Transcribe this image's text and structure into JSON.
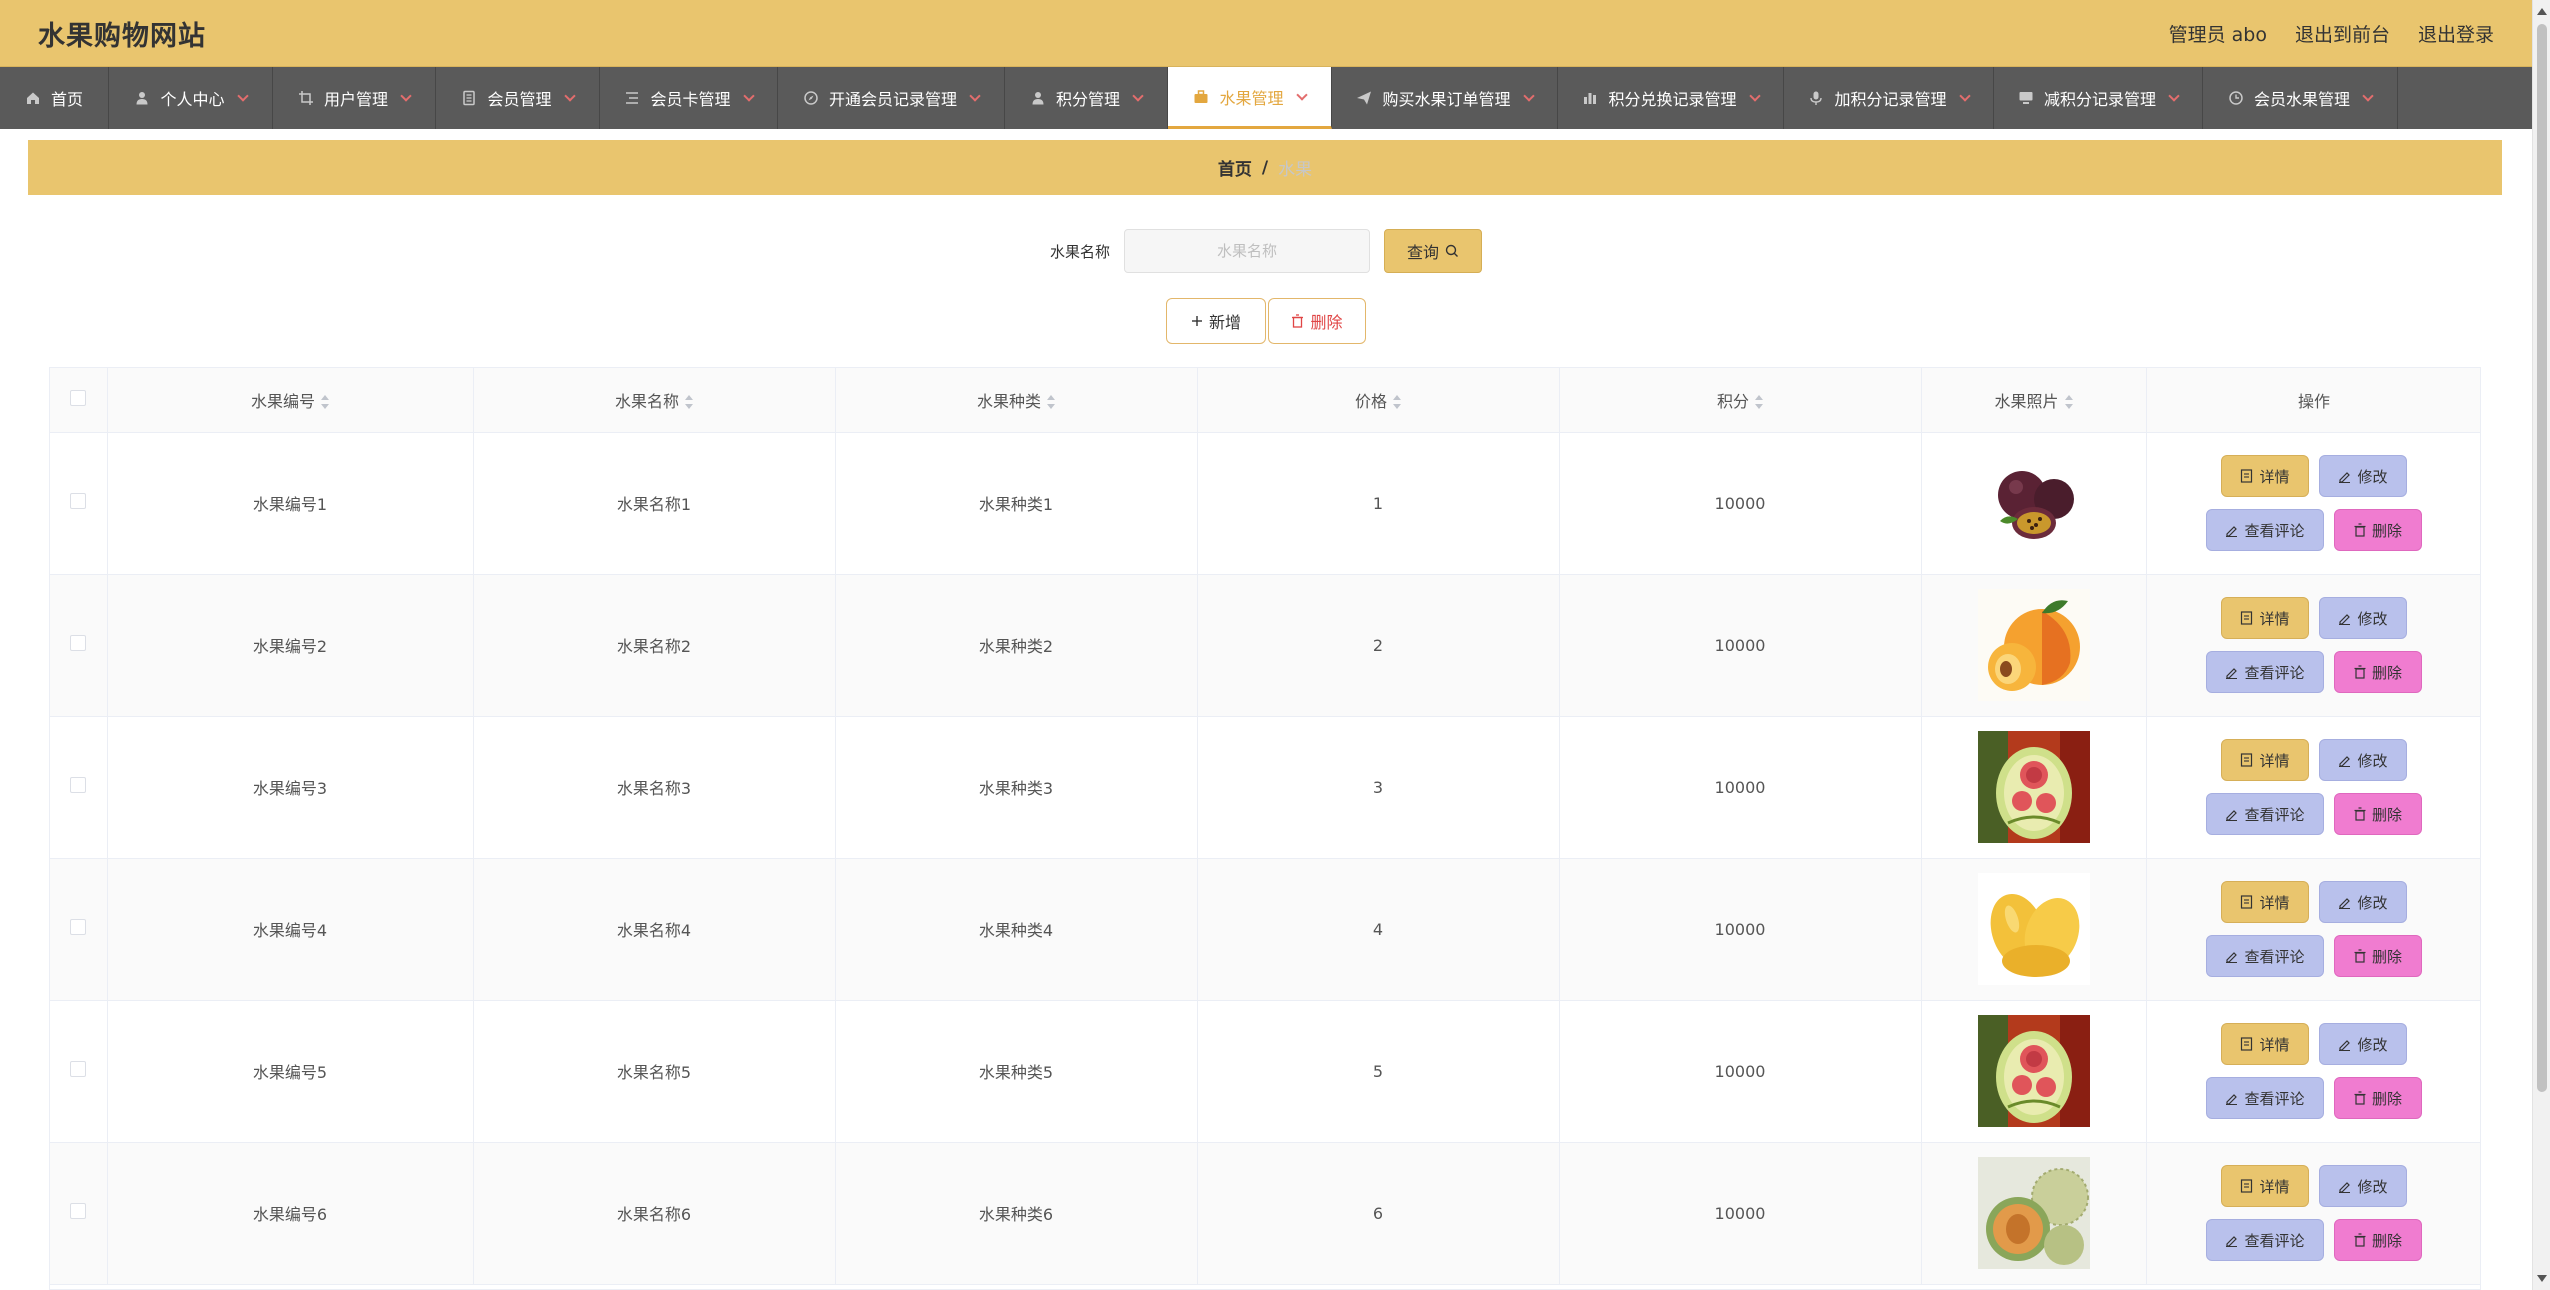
{
  "header": {
    "title": "水果购物网站",
    "admin_label": "管理员 abo",
    "to_front_label": "退出到前台",
    "logout_label": "退出登录"
  },
  "nav": {
    "items": [
      {
        "label": "首页",
        "icon": "home-icon",
        "has_caret": false,
        "active": false
      },
      {
        "label": "个人中心",
        "icon": "user-icon",
        "has_caret": true,
        "active": false
      },
      {
        "label": "用户管理",
        "icon": "crop-icon",
        "has_caret": true,
        "active": false
      },
      {
        "label": "会员管理",
        "icon": "document-icon",
        "has_caret": true,
        "active": false
      },
      {
        "label": "会员卡管理",
        "icon": "list-icon",
        "has_caret": true,
        "active": false
      },
      {
        "label": "开通会员记录管理",
        "icon": "compass-icon",
        "has_caret": true,
        "active": false
      },
      {
        "label": "积分管理",
        "icon": "user-icon",
        "has_caret": true,
        "active": false
      },
      {
        "label": "水果管理",
        "icon": "briefcase-icon",
        "has_caret": true,
        "active": true
      },
      {
        "label": "购买水果订单管理",
        "icon": "send-icon",
        "has_caret": true,
        "active": false
      },
      {
        "label": "积分兑换记录管理",
        "icon": "chart-icon",
        "has_caret": true,
        "active": false
      },
      {
        "label": "加积分记录管理",
        "icon": "microphone-icon",
        "has_caret": true,
        "active": false
      },
      {
        "label": "减积分记录管理",
        "icon": "monitor-icon",
        "has_caret": true,
        "active": false
      },
      {
        "label": "会员水果管理",
        "icon": "clock-icon",
        "has_caret": true,
        "active": false
      }
    ]
  },
  "breadcrumb": {
    "home": "首页",
    "separator": "/",
    "current": "水果"
  },
  "search": {
    "label": "水果名称",
    "placeholder": "水果名称",
    "button_label": "查询"
  },
  "actions": {
    "add_label": "新增",
    "delete_label": "删除"
  },
  "table": {
    "columns": [
      "水果编号",
      "水果名称",
      "水果种类",
      "价格",
      "积分",
      "水果照片",
      "操作"
    ],
    "op_labels": {
      "detail": "详情",
      "edit": "修改",
      "review": "查看评论",
      "delete": "删除"
    },
    "rows": [
      {
        "code": "水果编号1",
        "name": "水果名称1",
        "kind": "水果种类1",
        "price": "1",
        "points": "10000",
        "image": "passion-fruit"
      },
      {
        "code": "水果编号2",
        "name": "水果名称2",
        "kind": "水果种类2",
        "price": "2",
        "points": "10000",
        "image": "apricot"
      },
      {
        "code": "水果编号3",
        "name": "水果名称3",
        "kind": "水果种类3",
        "price": "3",
        "points": "10000",
        "image": "carved-watermelon"
      },
      {
        "code": "水果编号4",
        "name": "水果名称4",
        "kind": "水果种类4",
        "price": "4",
        "points": "10000",
        "image": "mango"
      },
      {
        "code": "水果编号5",
        "name": "水果名称5",
        "kind": "水果种类5",
        "price": "5",
        "points": "10000",
        "image": "carved-watermelon"
      },
      {
        "code": "水果编号6",
        "name": "水果名称6",
        "kind": "水果种类6",
        "price": "6",
        "points": "10000",
        "image": "melon"
      }
    ]
  },
  "colors": {
    "accent": "#e9c56e",
    "nav_bg": "#5a5a5a",
    "active_text": "#e3a73f",
    "edit_bg": "#b9c1ec",
    "delete_bg": "#f07cd0"
  }
}
